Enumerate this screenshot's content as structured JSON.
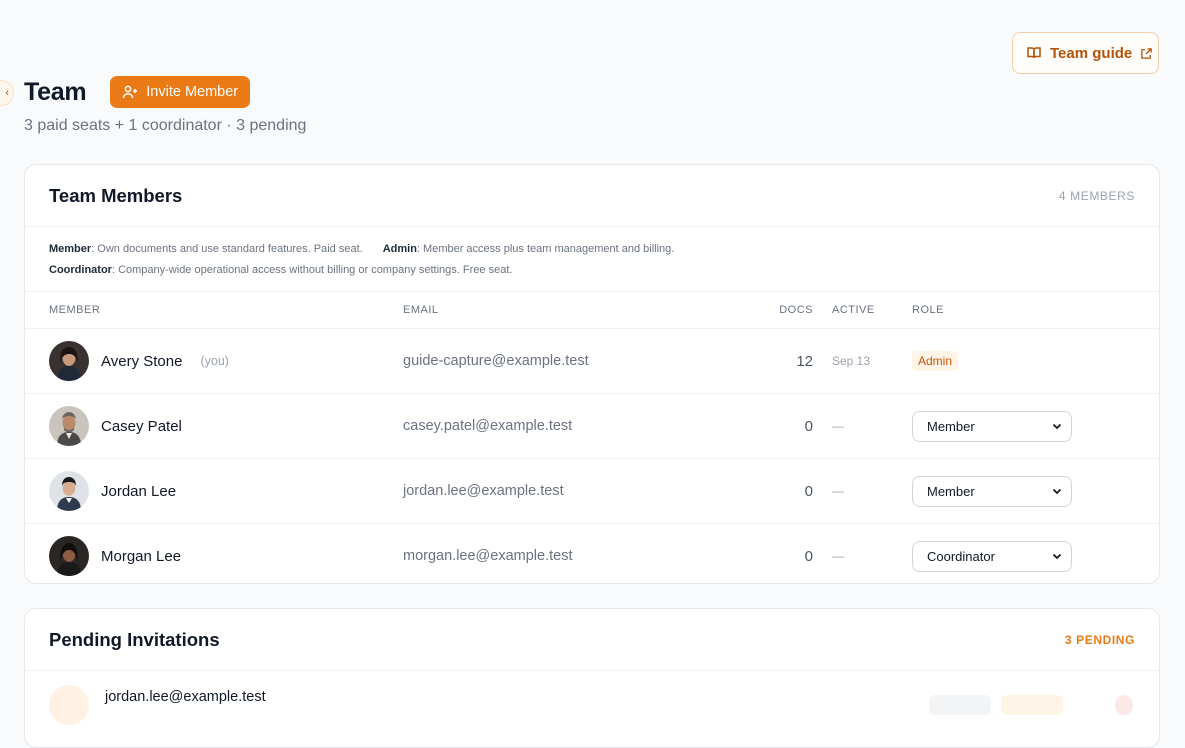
{
  "page": {
    "title": "Team",
    "subtitle": "3 paid seats + 1 coordinator · 3 pending",
    "invite_label": "Invite Member",
    "guide_label": "Team guide"
  },
  "members_card": {
    "title": "Team Members",
    "count": "4 MEMBERS",
    "legend": {
      "member_term": "Member",
      "member_desc": ": Own documents and use standard features. Paid seat.",
      "admin_term": "Admin",
      "admin_desc": ": Member access plus team management and billing.",
      "coordinator_term": "Coordinator",
      "coordinator_desc": ": Company-wide operational access without billing or company settings. Free seat."
    },
    "columns": {
      "member": "MEMBER",
      "email": "EMAIL",
      "docs": "DOCS",
      "active": "ACTIVE",
      "role": "ROLE"
    },
    "rows": [
      {
        "name": "Avery Stone",
        "you": "(you)",
        "email": "guide-capture@example.test",
        "docs": "12",
        "active": "Sep 13",
        "role": "Admin"
      },
      {
        "name": "Casey Patel",
        "email": "casey.patel@example.test",
        "docs": "0",
        "active": "—",
        "role": "Member"
      },
      {
        "name": "Jordan Lee",
        "email": "jordan.lee@example.test",
        "docs": "0",
        "active": "—",
        "role": "Member"
      },
      {
        "name": "Morgan Lee",
        "email": "morgan.lee@example.test",
        "docs": "0",
        "active": "—",
        "role": "Coordinator"
      }
    ]
  },
  "pending_card": {
    "title": "Pending Invitations",
    "count": "3 PENDING",
    "rows": [
      {
        "email": "jordan.lee@example.test"
      }
    ]
  },
  "colors": {
    "accent": "#ea7a16",
    "accent_text": "#b45309",
    "admin_badge_bg": "#fff4e6"
  }
}
